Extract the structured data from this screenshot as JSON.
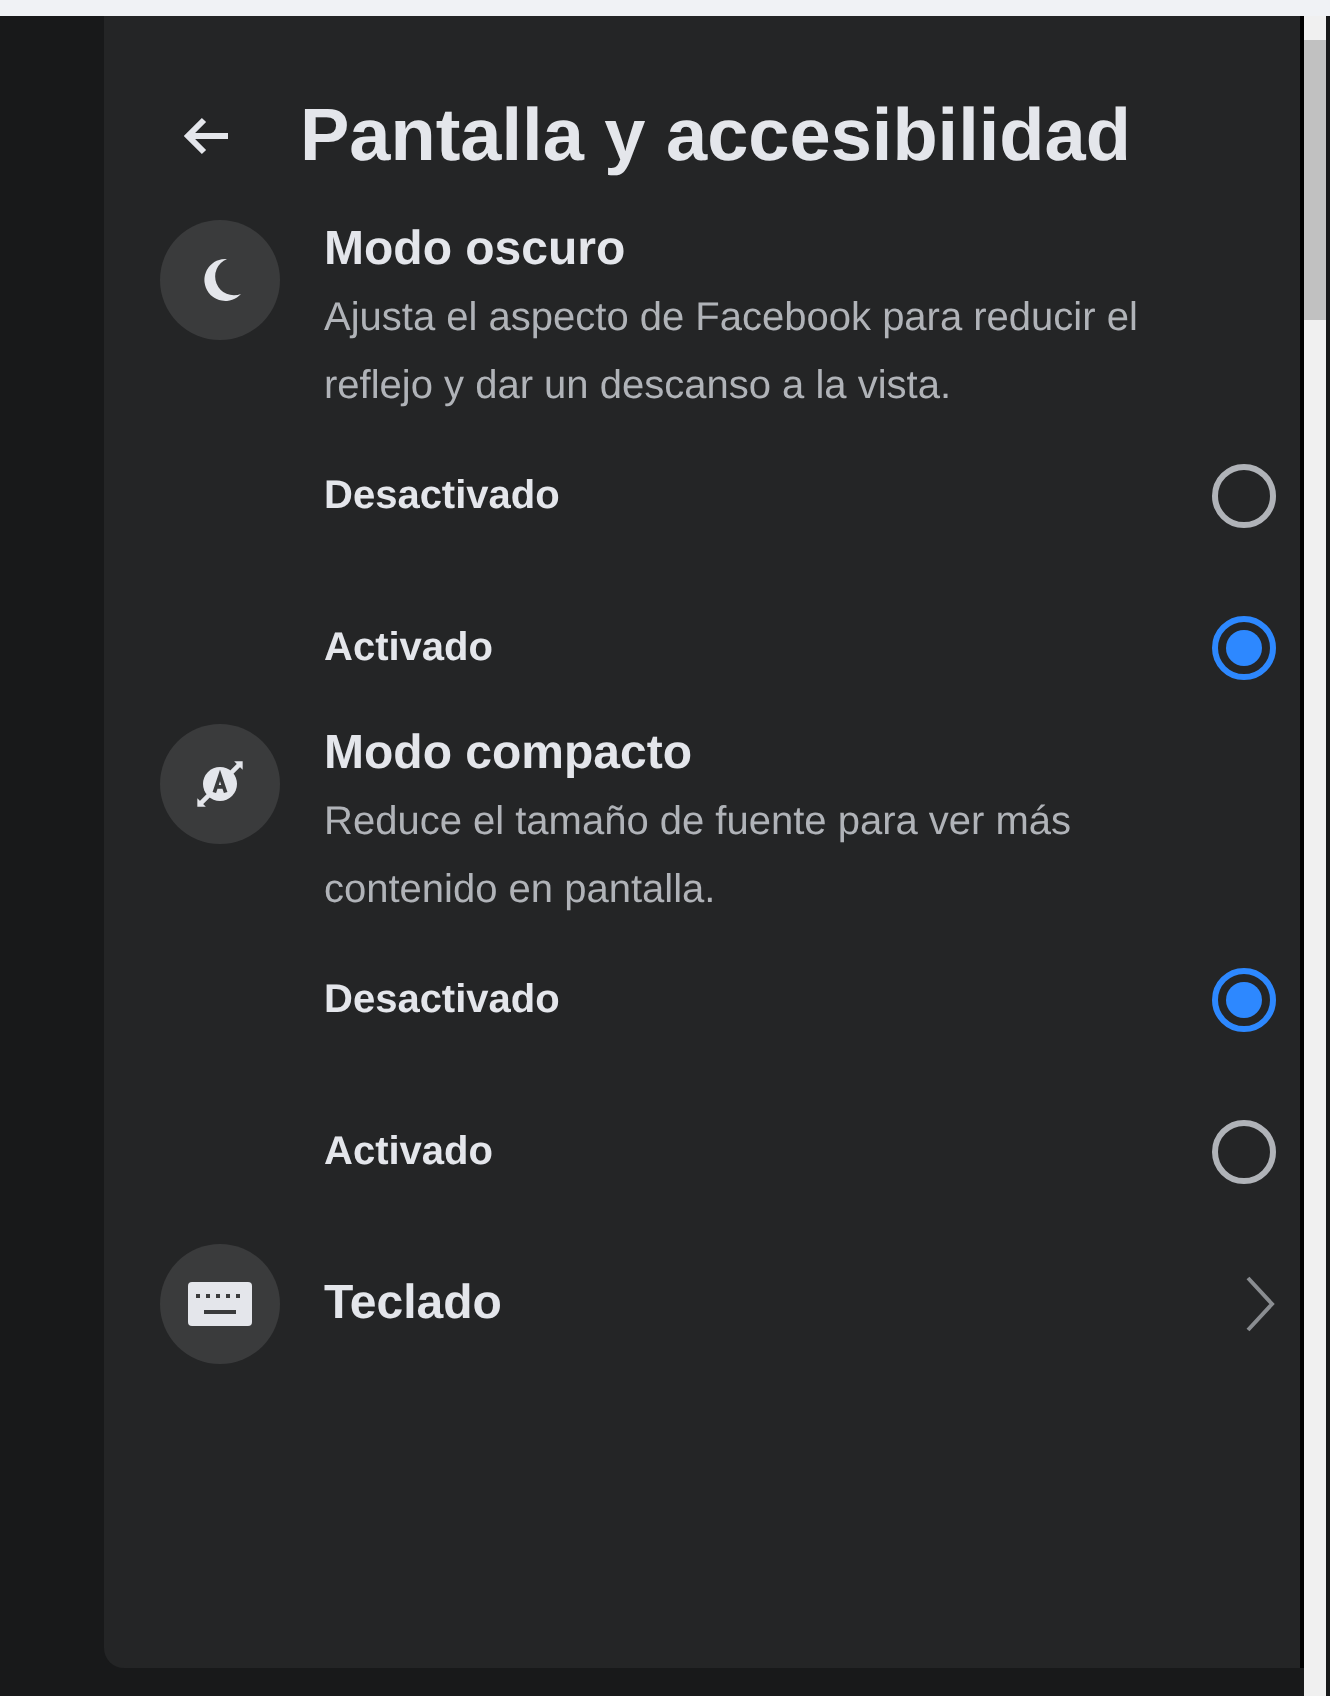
{
  "header": {
    "title": "Pantalla y accesibilidad"
  },
  "sections": [
    {
      "kind": "radio",
      "title": "Modo oscuro",
      "description": "Ajusta el aspecto de Facebook para reducir el reflejo y dar un descanso a la vista.",
      "options": [
        {
          "label": "Desactivado",
          "selected": false
        },
        {
          "label": "Activado",
          "selected": true
        }
      ]
    },
    {
      "kind": "radio",
      "title": "Modo compacto",
      "description": "Reduce el tamaño de fuente para ver más contenido en pantalla.",
      "options": [
        {
          "label": "Desactivado",
          "selected": true
        },
        {
          "label": "Activado",
          "selected": false
        }
      ]
    },
    {
      "kind": "link",
      "title": "Teclado"
    }
  ]
}
